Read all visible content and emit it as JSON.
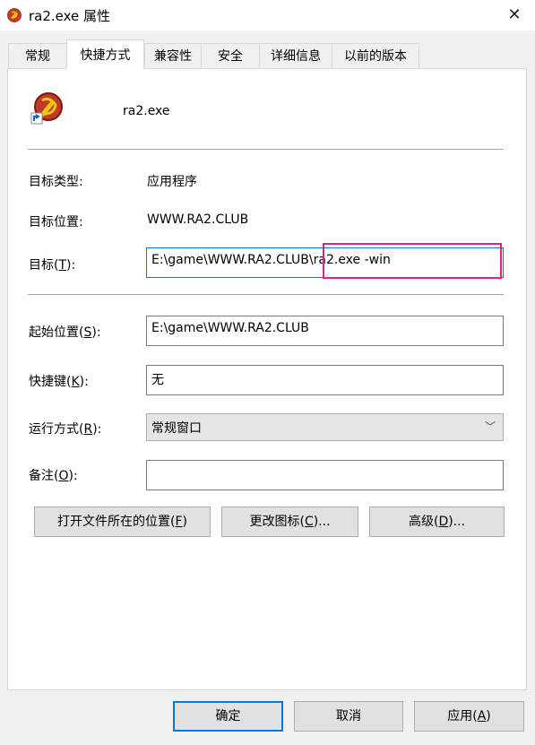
{
  "window": {
    "title": "ra2.exe 属性",
    "close_glyph": "✕"
  },
  "tabs": [
    {
      "label": "常规",
      "active": false
    },
    {
      "label": "快捷方式",
      "active": true
    },
    {
      "label": "兼容性",
      "active": false
    },
    {
      "label": "安全",
      "active": false
    },
    {
      "label": "详细信息",
      "active": false
    },
    {
      "label": "以前的版本",
      "active": false
    }
  ],
  "shortcut": {
    "file_name": "ra2.exe",
    "target_type_label": "目标类型:",
    "target_type_value": "应用程序",
    "target_location_label": "目标位置:",
    "target_location_value": "WWW.RA2.CLUB",
    "target_label_pre": "目标(",
    "target_label_key": "T",
    "target_label_post": "):",
    "target_value": "E:\\game\\WWW.RA2.CLUB\\ra2.exe -win",
    "start_in_label_pre": "起始位置(",
    "start_in_label_key": "S",
    "start_in_label_post": "):",
    "start_in_value": "E:\\game\\WWW.RA2.CLUB",
    "hotkey_label_pre": "快捷键(",
    "hotkey_label_key": "K",
    "hotkey_label_post": "):",
    "hotkey_value": "无",
    "run_label_pre": "运行方式(",
    "run_label_key": "R",
    "run_label_post": "):",
    "run_value": "常规窗口",
    "comment_label_pre": "备注(",
    "comment_label_key": "O",
    "comment_label_post": "):",
    "comment_value": ""
  },
  "action_buttons": {
    "open_location_pre": "打开文件所在的位置(",
    "open_location_key": "F",
    "open_location_post": ")",
    "change_icon_pre": "更改图标(",
    "change_icon_key": "C",
    "change_icon_post": ")...",
    "advanced_pre": "高级(",
    "advanced_key": "D",
    "advanced_post": ")..."
  },
  "footer": {
    "ok_label": "确定",
    "cancel_label": "取消",
    "apply_pre": "应用(",
    "apply_key": "A",
    "apply_post": ")"
  },
  "colors": {
    "accent": "#0078d7",
    "highlight_box": "#e0208c"
  }
}
